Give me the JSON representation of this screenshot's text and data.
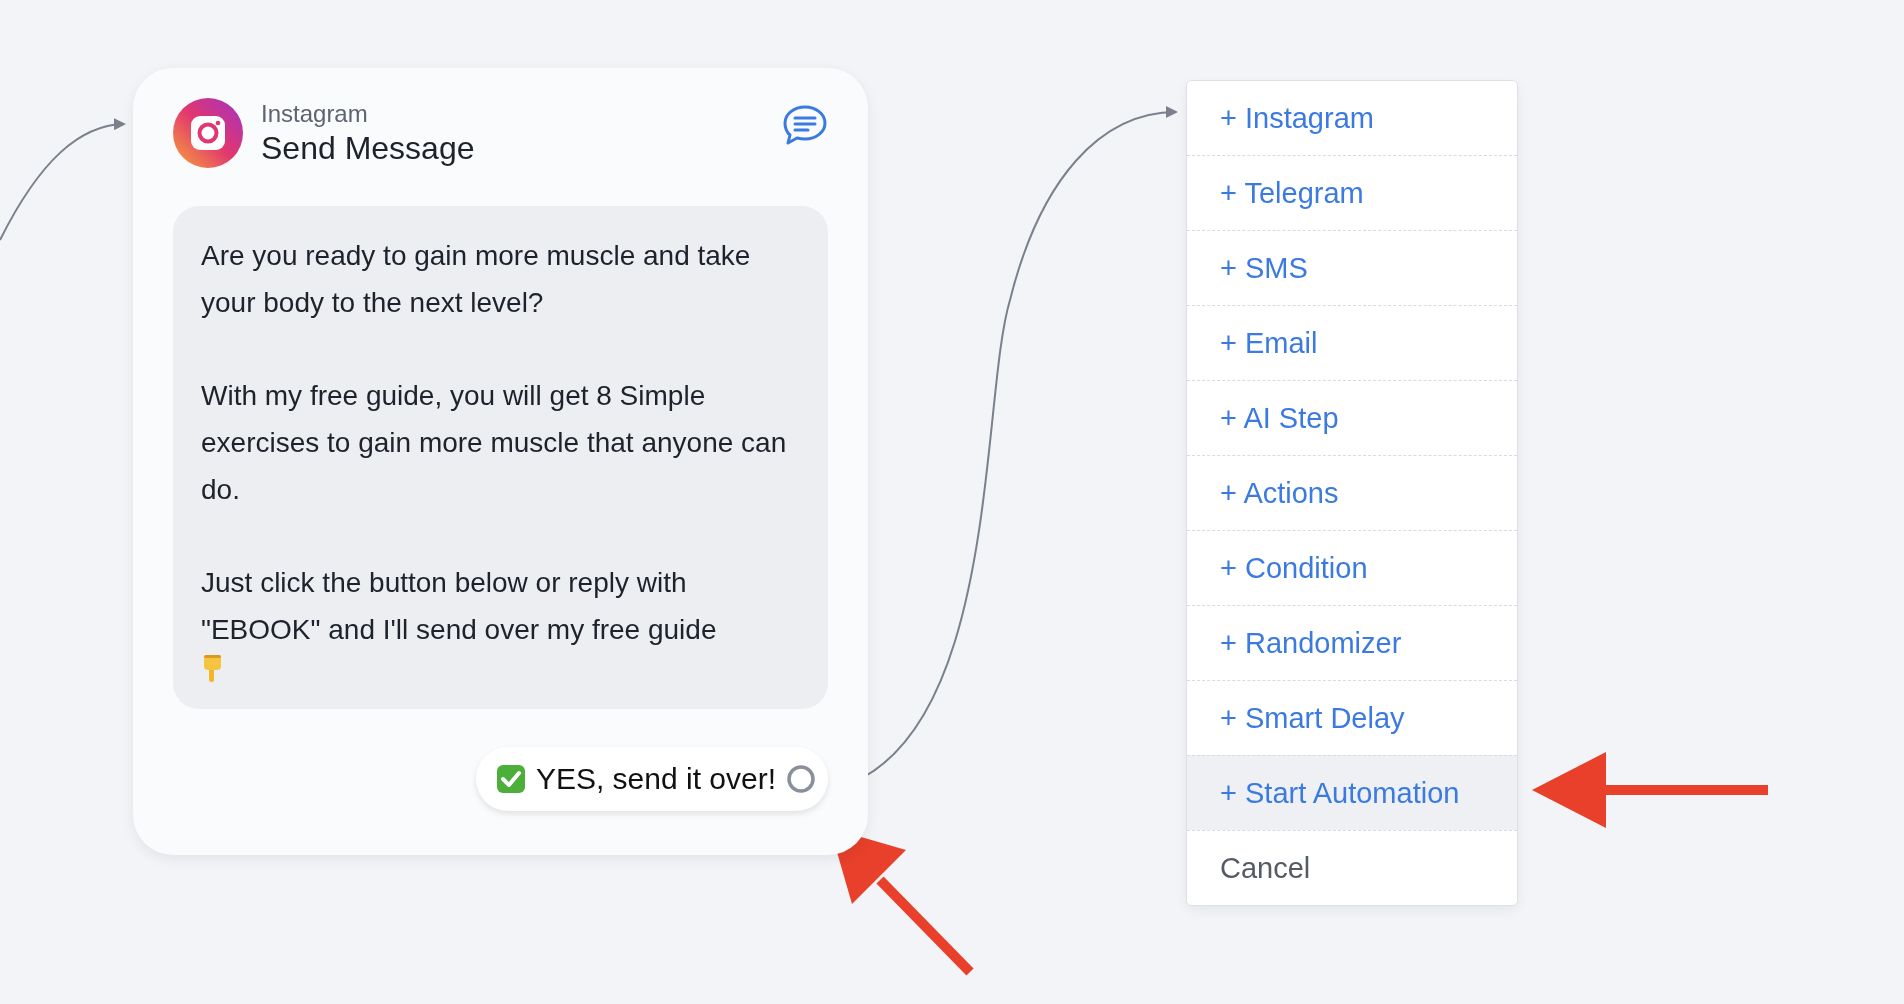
{
  "node": {
    "platform": "Instagram",
    "title": "Send Message",
    "message": [
      "Are you ready to gain more muscle and take your body to the next level?",
      "With my free guide, you will get 8 Simple exercises to gain more muscle that anyone can do.",
      "Just click the button below or reply with \"EBOOK\" and I'll send over my free guide"
    ],
    "quick_reply": {
      "label": "YES, send it over!"
    }
  },
  "menu": [
    {
      "label": "+ Instagram",
      "kind": "add",
      "selected": false
    },
    {
      "label": "+ Telegram",
      "kind": "add",
      "selected": false
    },
    {
      "label": "+ SMS",
      "kind": "add",
      "selected": false
    },
    {
      "label": "+ Email",
      "kind": "add",
      "selected": false
    },
    {
      "label": "+ AI Step",
      "kind": "add",
      "selected": false
    },
    {
      "label": "+ Actions",
      "kind": "add",
      "selected": false
    },
    {
      "label": "+ Condition",
      "kind": "add",
      "selected": false
    },
    {
      "label": "+ Randomizer",
      "kind": "add",
      "selected": false
    },
    {
      "label": "+ Smart Delay",
      "kind": "add",
      "selected": false
    },
    {
      "label": "+ Start Automation",
      "kind": "add",
      "selected": true
    },
    {
      "label": "Cancel",
      "kind": "cancel",
      "selected": false
    }
  ]
}
